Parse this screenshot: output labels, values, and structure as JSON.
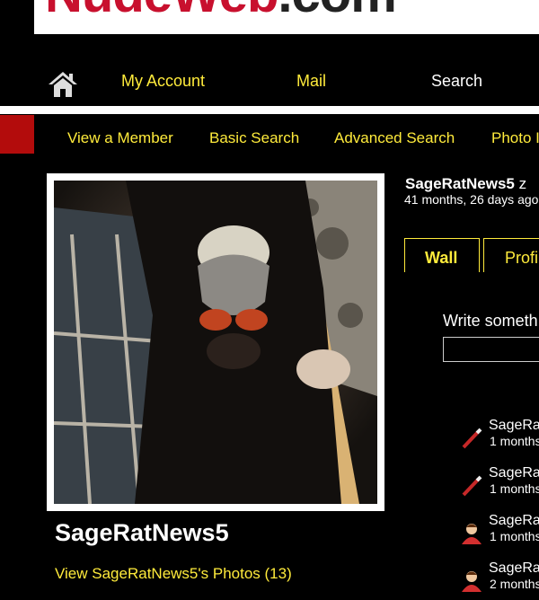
{
  "logo": {
    "part1": "NudeWeb",
    "part2": ".com"
  },
  "nav_primary": {
    "my_account": "My Account",
    "mail": "Mail",
    "search": "Search"
  },
  "nav_secondary": {
    "view_member": "View a Member",
    "basic_search": "Basic Search",
    "advanced_search": "Advanced Search",
    "photos": "Photo I"
  },
  "member": {
    "name": "SageRatNews5",
    "photos_link": "View SageRatNews5's Photos (13)"
  },
  "profile_header": {
    "name": "SageRatNews5",
    "suffix": "z",
    "time": "41 months, 26 days ago"
  },
  "tabs": [
    {
      "label": "Wall"
    },
    {
      "label": "Profi"
    }
  ],
  "wall": {
    "write_prompt": "Write someth",
    "write_placeholder": ""
  },
  "activity": [
    {
      "name": "SageRa",
      "time": "1 months",
      "icon": "pencil-icon"
    },
    {
      "name": "SageRa",
      "time": "1 months",
      "icon": "pencil-icon"
    },
    {
      "name": "SageRa",
      "time": "1 months",
      "icon": "person-icon"
    },
    {
      "name": "SageRa",
      "time": "2 months",
      "icon": "person-icon"
    }
  ],
  "colors": {
    "accent": "#ffeb3b",
    "brand": "#c8102e",
    "background": "#000000"
  }
}
